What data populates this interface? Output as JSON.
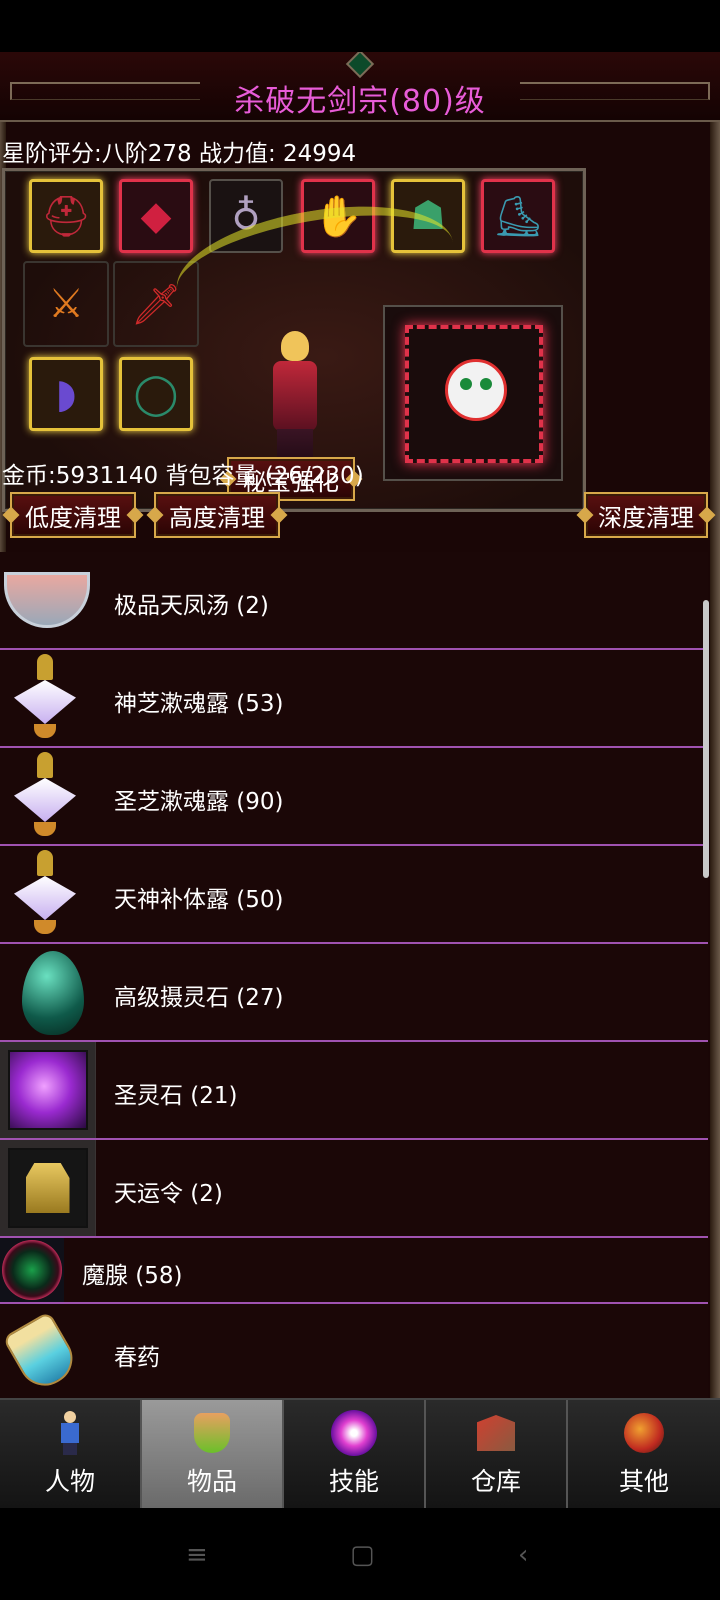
{
  "header": {
    "title": "杀破无剑宗(80)级"
  },
  "stats": {
    "rating_line": "星阶评分:八阶278 战力值: 24994"
  },
  "equipment": {
    "slots": [
      {
        "icon": "helmet-icon"
      },
      {
        "icon": "armor-icon"
      },
      {
        "icon": "necklace-icon"
      },
      {
        "icon": "gloves-icon"
      },
      {
        "icon": "belt-icon"
      },
      {
        "icon": "boots-icon"
      },
      {
        "icon": "weapon-icon"
      },
      {
        "icon": "sword-icon"
      },
      {
        "icon": "bracer-icon"
      },
      {
        "icon": "ring-icon"
      }
    ],
    "treasure_button": "秘宝强化",
    "pet_icon": "fire-pet-icon"
  },
  "inventory": {
    "gold_line": "金币:5931140 背包容量 (26/230)",
    "cleanup_buttons": {
      "low": "低度清理",
      "high": "高度清理",
      "deep": "深度清理"
    },
    "items": [
      {
        "name": "极品天凤汤 (2)",
        "icon": "soup-bowl-icon"
      },
      {
        "name": "神芝漱魂露 (53)",
        "icon": "potion-bottle-icon"
      },
      {
        "name": "圣芝漱魂露 (90)",
        "icon": "potion-bottle-icon"
      },
      {
        "name": "天神补体露 (50)",
        "icon": "potion-bottle-icon"
      },
      {
        "name": "高级摄灵石 (27)",
        "icon": "green-stone-icon"
      },
      {
        "name": "圣灵石 (21)",
        "icon": "purple-stone-icon"
      },
      {
        "name": "天运令 (2)",
        "icon": "token-icon"
      },
      {
        "name": "魔腺 (58)",
        "icon": "orb-icon"
      },
      {
        "name": "春药",
        "icon": "flask-icon"
      }
    ]
  },
  "tabs": [
    {
      "label": "人物",
      "icon": "character-icon",
      "active": false
    },
    {
      "label": "物品",
      "icon": "items-icon",
      "active": true
    },
    {
      "label": "技能",
      "icon": "skills-icon",
      "active": false
    },
    {
      "label": "仓库",
      "icon": "warehouse-icon",
      "active": false
    },
    {
      "label": "其他",
      "icon": "other-icon",
      "active": false
    }
  ],
  "system_nav": {
    "menu": "≡",
    "home": "▢",
    "back": "‹"
  },
  "colors": {
    "title": "#e85cd8",
    "divider": "#a052b0",
    "gold_frame": "#d7a84a"
  }
}
